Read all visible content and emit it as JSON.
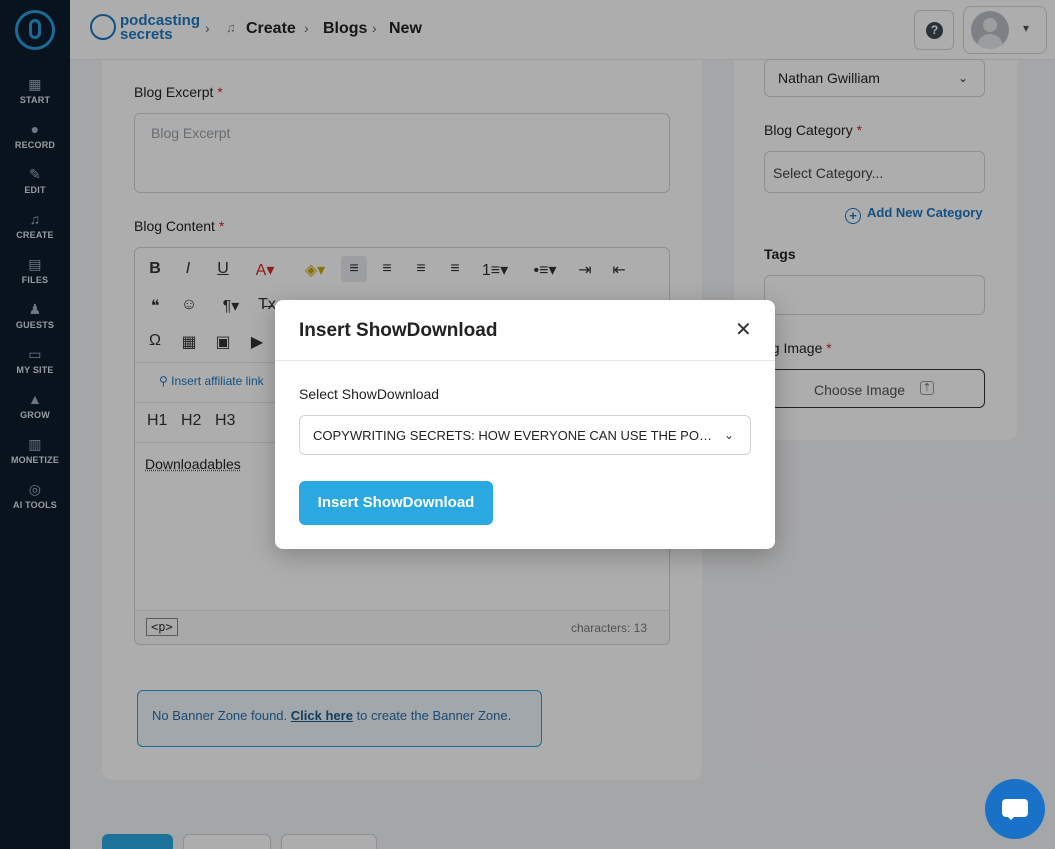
{
  "sidebar": {
    "items": [
      {
        "label": "START",
        "icon": "start-icon"
      },
      {
        "label": "RECORD",
        "icon": "microphone-icon"
      },
      {
        "label": "EDIT",
        "icon": "edit-icon"
      },
      {
        "label": "CREATE",
        "icon": "create-icon"
      },
      {
        "label": "FILES",
        "icon": "files-icon"
      },
      {
        "label": "GUESTS",
        "icon": "guests-icon"
      },
      {
        "label": "MY SITE",
        "icon": "site-icon"
      },
      {
        "label": "GROW",
        "icon": "grow-icon"
      },
      {
        "label": "MONETIZE",
        "icon": "monetize-icon"
      },
      {
        "label": "AI TOOLS",
        "icon": "ai-tools-icon"
      }
    ]
  },
  "header": {
    "brand_line1": "podcasting",
    "brand_line2": "secrets",
    "breadcrumbs": [
      "Create",
      "Blogs",
      "New"
    ],
    "help_glyph": "?"
  },
  "form": {
    "excerpt_label": "Blog Excerpt",
    "excerpt_placeholder": "Blog Excerpt",
    "content_label": "Blog Content",
    "required_mark": "*",
    "affiliate_link_label": "Insert affiliate link",
    "heading_buttons": [
      "H1",
      "H2",
      "H3"
    ],
    "content_text": "Downloadables",
    "p_tag": "<p>",
    "char_count": "characters: 13",
    "banner_prefix": "No Banner Zone found.",
    "banner_link": "Click here",
    "banner_suffix": "to create the Banner Zone."
  },
  "toolbar": {
    "row1": [
      "B",
      "I",
      "U",
      "A▾",
      "◈▾",
      "≡",
      "≡",
      "≡",
      "≡",
      "1≡▾",
      "•≡▾",
      "⇥",
      "⇤"
    ],
    "row2": [
      "❝",
      "☺",
      "¶▾",
      "T̶x"
    ],
    "row3": [
      "Ω",
      "▦",
      "▣",
      "▶"
    ]
  },
  "sidebar_right": {
    "author_value": "Nathan Gwilliam",
    "category_label": "Blog Category",
    "category_placeholder": "Select Category...",
    "add_category_label": "Add New Category",
    "tags_label": "Tags",
    "image_label": "Blog Image",
    "image_label_visible": "og Image",
    "choose_image_label": "Choose Image"
  },
  "modal": {
    "title": "Insert ShowDownload",
    "field_label": "Select ShowDownload",
    "selected_value": "COPYWRITING SECRETS: HOW EVERYONE CAN USE THE POWER OF WORDS",
    "selected_value_visible": "COPYWRITING SECRETS: HOW EVERYONE CAN USE THE POW...",
    "submit_label": "Insert ShowDownload",
    "close_glyph": "✕"
  },
  "colors": {
    "sidebar_bg": "#0c1d2b",
    "accent": "#2aa8e0",
    "link": "#1d78c1",
    "required": "#d12a2a"
  }
}
